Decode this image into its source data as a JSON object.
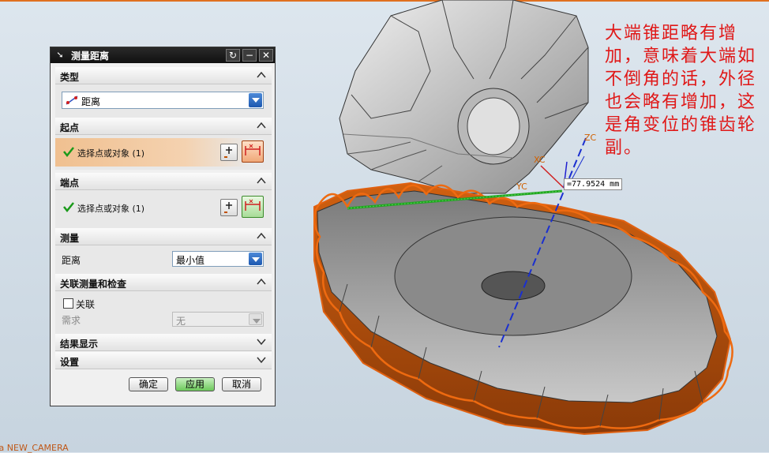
{
  "dialog": {
    "title": "测量距离",
    "sections": {
      "type": {
        "label": "类型",
        "value": "距离"
      },
      "start": {
        "label": "起点",
        "selection": "选择点或对象 (1)"
      },
      "end": {
        "label": "端点",
        "selection": "选择点或对象 (1)"
      },
      "measure": {
        "label": "测量",
        "field_label": "距离",
        "value": "最小值"
      },
      "assoc": {
        "label": "关联测量和检查",
        "checkbox_label": "关联",
        "require_label": "需求",
        "require_value": "无"
      },
      "results": {
        "label": "结果显示"
      },
      "settings": {
        "label": "设置"
      }
    },
    "buttons": {
      "ok": "确定",
      "apply": "应用",
      "cancel": "取消"
    }
  },
  "viewport": {
    "measurement": "=77.9524 mm",
    "axes": {
      "zc": "ZC",
      "xc": "XC",
      "yc": "YC"
    },
    "annotation": "大端锥距略有增加，意味着大端如不倒角的话，外径也会略有增加，这是角变位的锥齿轮副。",
    "camera": "ra NEW_CAMERA"
  },
  "colors": {
    "accent": "#e07020",
    "annotation": "#e01818",
    "check": "#1a9a1a"
  }
}
